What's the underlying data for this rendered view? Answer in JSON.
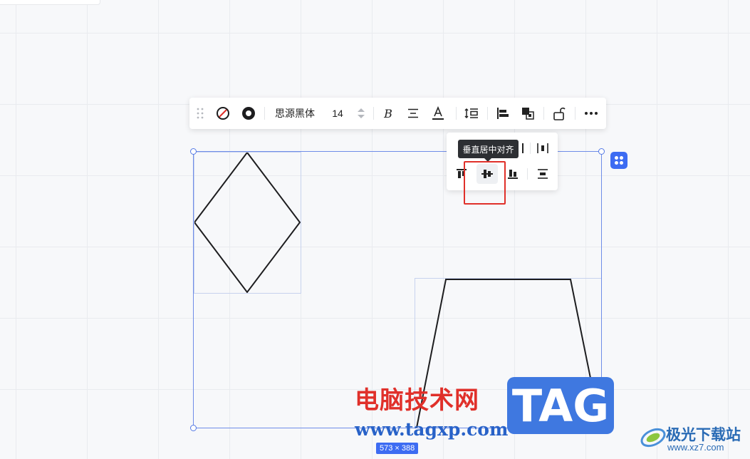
{
  "toolbar": {
    "font_name": "思源黑体",
    "font_size": "14",
    "icons": [
      "drag-handle-icon",
      "no-fill-icon",
      "stroke-circle-icon",
      "bold-icon",
      "text-align-icon",
      "text-color-icon",
      "line-spacing-icon",
      "align-icon",
      "arrange-icon",
      "lock-icon",
      "more-icon"
    ]
  },
  "align_popover": {
    "tooltip": "垂直居中对齐",
    "selected": "vertical-center-align"
  },
  "selection": {
    "size_label": "573 × 388"
  },
  "watermark": {
    "site_cn": "电脑技术网",
    "site_url": "www.tagxp.com",
    "tag": "TAG",
    "logo_name": "极光下载站",
    "logo_url": "www.xz7.com"
  },
  "colors": {
    "accent": "#3d6cf2",
    "highlight": "#e0302a",
    "watermark_red": "#e0302a",
    "watermark_blue": "#2862c8"
  }
}
